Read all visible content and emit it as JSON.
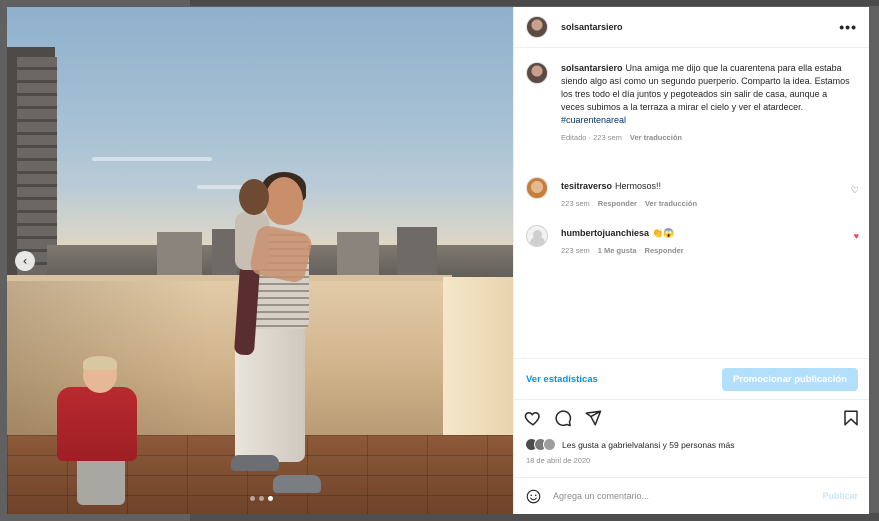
{
  "post": {
    "username": "solsantarsiero",
    "more_label": "•••",
    "caption_user": "solsantarsiero",
    "caption_text": "Una amiga me dijo que la cuarentena para ella estaba siendo algo así como un segundo puerperio. Comparto la idea. Estamos los tres todo el día juntos y pegoteados sin salir de casa, aunque a veces subimos a la terraza a mirar el cielo y ver el atardecer.",
    "hashtag": "#cuarentenareal",
    "caption_meta_edited": "Editado · 223 sem",
    "caption_meta_translate": "Ver traducción",
    "photo_nav_prev": "‹",
    "carousel_index": 3,
    "carousel_count": 3
  },
  "comments": [
    {
      "user": "tesitraverso",
      "text": "Hermosos!!",
      "time": "223 sem",
      "reply": "Responder",
      "translate": "Ver traducción",
      "liked": false
    },
    {
      "user": "humbertojuanchiesa",
      "text": "👏😱",
      "time": "223 sem",
      "likes": "1 Me gusta",
      "reply": "Responder",
      "liked": true
    }
  ],
  "actions": {
    "stats_label": "Ver estadísticas",
    "promote_label": "Promocionar publicación"
  },
  "likes": {
    "text": "Les gusta a gabrielvalansi y 59 personas más",
    "date": "18 de abril de 2020"
  },
  "composer": {
    "placeholder": "Agrega un comentario...",
    "publish_label": "Publicar"
  },
  "colors": {
    "link": "#0095f6",
    "promote_bg": "#b2dffc",
    "heart_filled": "#ed4956",
    "hashtag": "#00376b"
  }
}
